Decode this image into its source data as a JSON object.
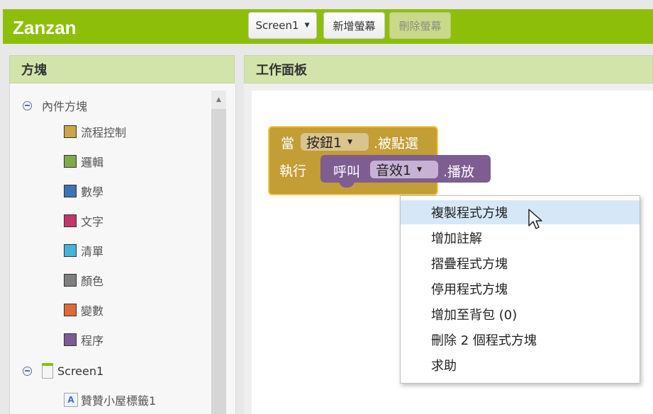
{
  "app": {
    "brand": "Zanzan"
  },
  "toolbar": {
    "screen_select": "Screen1",
    "add_screen": "新增螢幕",
    "remove_screen": "刪除螢幕"
  },
  "blocks_panel": {
    "title": "方塊",
    "builtin": "內件方塊",
    "categories": [
      {
        "label": "流程控制",
        "color": "#c9a648"
      },
      {
        "label": "邏輯",
        "color": "#7faa48"
      },
      {
        "label": "數學",
        "color": "#3e74b6"
      },
      {
        "label": "文字",
        "color": "#c2366b"
      },
      {
        "label": "清單",
        "color": "#46b3d9"
      },
      {
        "label": "顏色",
        "color": "#7f7f7f"
      },
      {
        "label": "變數",
        "color": "#de6b36"
      },
      {
        "label": "程序",
        "color": "#7d5c93"
      }
    ],
    "screen": "Screen1",
    "component": "贊贊小屋標籤1"
  },
  "workspace": {
    "title": "工作面板",
    "event_block": {
      "when": "當",
      "component": "按鈕1",
      "event": ".被點選",
      "do": "執行",
      "call": "呼叫",
      "target": "音效1",
      "method": ".播放"
    }
  },
  "context_menu": {
    "items": [
      "複製程式方塊",
      "增加註解",
      "摺疊程式方塊",
      "停用程式方塊",
      "增加至背包 (0)",
      "刪除 2 個程式方塊",
      "求助"
    ]
  }
}
